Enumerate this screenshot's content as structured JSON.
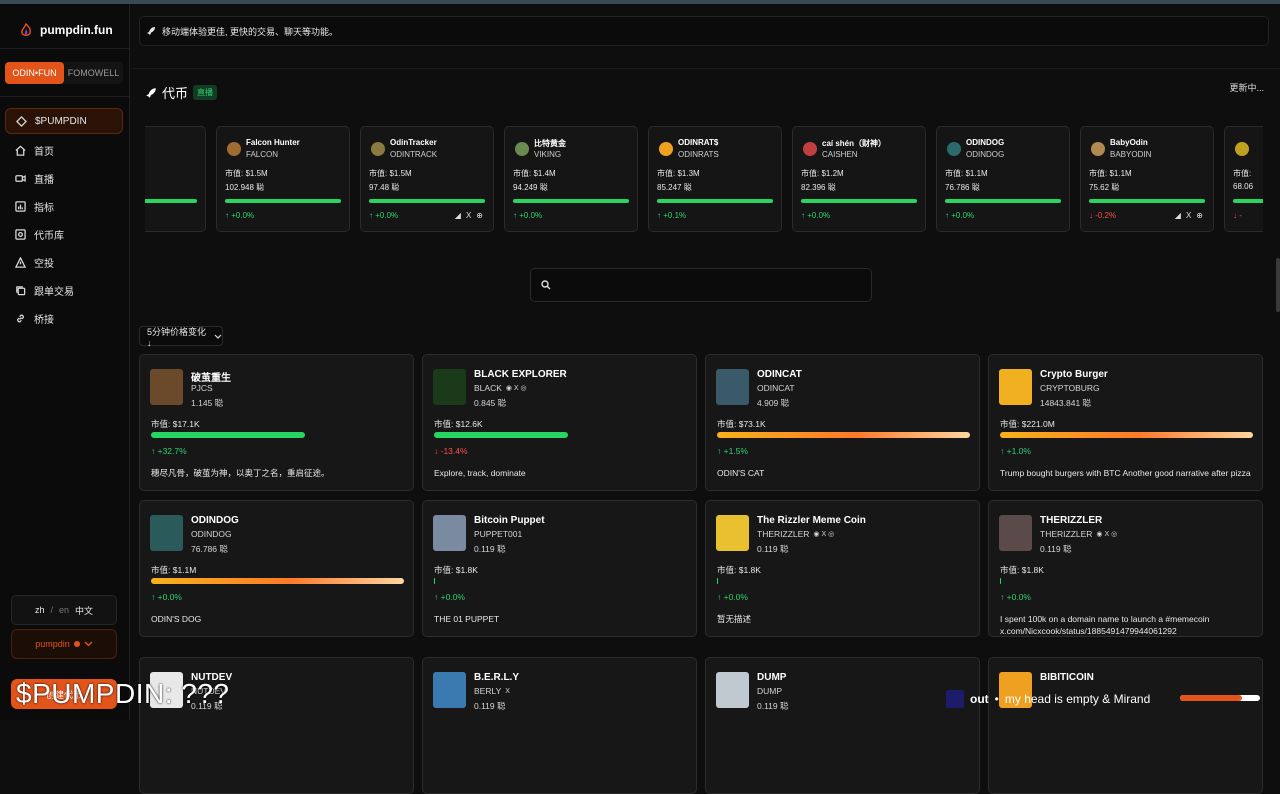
{
  "app": {
    "logo_text": "pumpdin.fun"
  },
  "segments": [
    {
      "label": "ODIN•FUN",
      "active": true
    },
    {
      "label": "FOMOWELL",
      "active": false
    }
  ],
  "nav": [
    {
      "label": "$PUMPDIN",
      "icon": "diamond-icon",
      "active": true
    },
    {
      "label": "首页",
      "icon": "home-icon"
    },
    {
      "label": "直播",
      "icon": "video-icon"
    },
    {
      "label": "指标",
      "icon": "chart-icon"
    },
    {
      "label": "代币库",
      "icon": "vault-icon"
    },
    {
      "label": "空投",
      "icon": "warning-icon"
    },
    {
      "label": "跟单交易",
      "icon": "copy-icon"
    },
    {
      "label": "桥接",
      "icon": "link-icon"
    }
  ],
  "lang": {
    "zh": "zh",
    "sep": "/",
    "en": "en",
    "current": "中文"
  },
  "user_button": "pumpdin",
  "create_button": "创建代币",
  "notice": "移动端体验更佳, 更快的交易、聊天等功能。",
  "coins_section": {
    "title": "代币",
    "live_badge": "直播",
    "updating": "更新中..."
  },
  "ticker_cards": [
    {
      "name": "",
      "ticker": "",
      "mcap": "",
      "sats": "",
      "change": "",
      "trend": "up",
      "fill": 1.0,
      "socials": false,
      "logo_color": "#333"
    },
    {
      "name": "Falcon Hunter",
      "ticker": "FALCON",
      "mcap": "市值: $1.5M",
      "sats": "102.948 聪",
      "change": "↑ +0.0%",
      "trend": "up",
      "fill": 1.0,
      "socials": false,
      "logo_color": "#a06a30"
    },
    {
      "name": "OdinTracker",
      "ticker": "ODINTRACK",
      "mcap": "市值: $1.5M",
      "sats": "97.48 聪",
      "change": "↑ +0.0%",
      "trend": "up",
      "fill": 1.0,
      "socials": true,
      "logo_color": "#8a7a40"
    },
    {
      "name": "比特黄金",
      "ticker": "VIKING",
      "mcap": "市值: $1.4M",
      "sats": "94.249 聪",
      "change": "↑ +0.0%",
      "trend": "up",
      "fill": 1.0,
      "socials": false,
      "logo_color": "#6a8a50"
    },
    {
      "name": "ODINRAT$",
      "ticker": "ODINRATS",
      "mcap": "市值: $1.3M",
      "sats": "85.247 聪",
      "change": "↑ +0.1%",
      "trend": "up",
      "fill": 1.0,
      "socials": false,
      "logo_color": "#f0a020"
    },
    {
      "name": "caí shén（财神）",
      "ticker": "CAISHEN",
      "mcap": "市值: $1.2M",
      "sats": "82.396 聪",
      "change": "↑ +0.0%",
      "trend": "up",
      "fill": 1.0,
      "socials": false,
      "logo_color": "#c04040"
    },
    {
      "name": "ODINDOG",
      "ticker": "ODINDOG",
      "mcap": "市值: $1.1M",
      "sats": "76.786 聪",
      "change": "↑ +0.0%",
      "trend": "up",
      "fill": 1.0,
      "socials": false,
      "logo_color": "#2a6a6a"
    },
    {
      "name": "BabyOdin",
      "ticker": "BABYODIN",
      "mcap": "市值: $1.1M",
      "sats": "75.62 聪",
      "change": "↓ -0.2%",
      "trend": "down",
      "fill": 1.0,
      "socials": true,
      "logo_color": "#b08a50"
    },
    {
      "name": "",
      "ticker": "",
      "mcap": "市值:",
      "sats": "68.06",
      "change": "↓ -",
      "trend": "down",
      "fill": 1.0,
      "socials": false,
      "logo_color": "#c0a020"
    }
  ],
  "search": {
    "placeholder": "",
    "value": ""
  },
  "sort": {
    "label": "5分钟价格变化↓"
  },
  "grid_cards": [
    {
      "name": "破茧重生",
      "ticker": "PJCS",
      "sats": "1.145 聪",
      "mcap": "市值: $17.1K",
      "fill": 0.61,
      "bar": "green",
      "change": "↑ +32.7%",
      "trend": "up",
      "desc": "穗尽凡骨，破茧为神，以奥丁之名，重启征途。",
      "socials": "",
      "img_color": "#6a4a2a"
    },
    {
      "name": "BLACK EXPLORER",
      "ticker": "BLACK",
      "sats": "0.845 聪",
      "mcap": "市值: $12.6K",
      "fill": 0.53,
      "bar": "green",
      "change": "↓ -13.4%",
      "trend": "down",
      "desc": "Explore, track, dominate",
      "socials": "◉ X ◎",
      "img_color": "#1a3a1a"
    },
    {
      "name": "ODINCAT",
      "ticker": "ODINCAT",
      "sats": "4.909 聪",
      "mcap": "市值: $73.1K",
      "fill": 1.0,
      "bar": "hot",
      "change": "↑ +1.5%",
      "trend": "up",
      "desc": "ODIN'S CAT",
      "socials": "",
      "img_color": "#3a5a6a"
    },
    {
      "name": "Crypto Burger",
      "ticker": "CRYPTOBURG",
      "sats": "14843.841 聪",
      "mcap": "市值: $221.0M",
      "fill": 1.0,
      "bar": "hot",
      "change": "↑ +1.0%",
      "trend": "up",
      "desc": "Trump bought burgers with BTC Another good narrative after pizza",
      "socials": "",
      "img_color": "#f0b020"
    },
    {
      "name": "ODINDOG",
      "ticker": "ODINDOG",
      "sats": "76.786 聪",
      "mcap": "市值: $1.1M",
      "fill": 1.0,
      "bar": "hot",
      "change": "↑ +0.0%",
      "trend": "up",
      "desc": "ODIN'S DOG",
      "socials": "",
      "img_color": "#2a5a5a"
    },
    {
      "name": "Bitcoin Puppet",
      "ticker": "PUPPET001",
      "sats": "0.119 聪",
      "mcap": "市值: $1.8K",
      "fill": 0.004,
      "bar": "green",
      "change": "↑ +0.0%",
      "trend": "up",
      "desc": "THE 01 PUPPET",
      "socials": "",
      "img_color": "#7a8aa0"
    },
    {
      "name": "The Rizzler Meme Coin",
      "ticker": "THERIZZLER",
      "sats": "0.119 聪",
      "mcap": "市值: $1.8K",
      "fill": 0.004,
      "bar": "green",
      "change": "↑ +0.0%",
      "trend": "up",
      "desc": "暂无描述",
      "socials": "◉ X ◎",
      "img_color": "#e8c030"
    },
    {
      "name": "THERIZZLER",
      "ticker": "THERIZZLER",
      "sats": "0.119 聪",
      "mcap": "市值: $1.8K",
      "fill": 0.004,
      "bar": "green",
      "change": "↑ +0.0%",
      "trend": "up",
      "desc": "I spent 100k on a domain name to launch a #memecoin x.com/Nicxcook/status/1885491479944061292",
      "socials": "◉ X ◎",
      "img_color": "#5a4a4a"
    },
    {
      "name": "NUTDEV",
      "ticker": "NUTDEV",
      "sats": "0.119 聪",
      "mcap": "",
      "fill": 0,
      "bar": "green",
      "change": "",
      "trend": "up",
      "desc": "",
      "socials": "",
      "img_color": "#e8e8e8"
    },
    {
      "name": "B.E.R.L.Y",
      "ticker": "BERLY",
      "sats": "0.119 聪",
      "mcap": "",
      "fill": 0,
      "bar": "green",
      "change": "",
      "trend": "up",
      "desc": "",
      "socials": "X",
      "img_color": "#3a7ab0"
    },
    {
      "name": "DUMP",
      "ticker": "DUMP",
      "sats": "0.119 聪",
      "mcap": "",
      "fill": 0,
      "bar": "green",
      "change": "",
      "trend": "up",
      "desc": "",
      "socials": "",
      "img_color": "#c0c8d0"
    },
    {
      "name": "BIBITICOIN",
      "ticker": "",
      "sats": "",
      "mcap": "",
      "fill": 0,
      "bar": "green",
      "change": "",
      "trend": "up",
      "desc": "",
      "socials": "",
      "img_color": "#f0a020"
    }
  ],
  "overlay": {
    "title": "$PUMPDIN: ???"
  },
  "now_playing": {
    "label": "out",
    "bullet": "•",
    "track": "my head is empty & Mirand",
    "progress": 0.78
  },
  "colors": {
    "accent": "#e2541a",
    "up": "#2dd36f",
    "down": "#ff4d4d"
  }
}
